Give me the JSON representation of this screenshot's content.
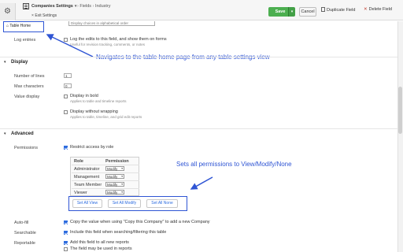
{
  "toolbar": {
    "app_name": "Companies Settings",
    "crumb_1": "Fields",
    "crumb_2": "Industry",
    "exit_label": "Exit Settings",
    "save_label": "Save",
    "cancel_label": "Cancel",
    "duplicate_label": "Duplicate Field",
    "delete_label": "Delete Field"
  },
  "table_home": {
    "label": "Table Home"
  },
  "top": {
    "dropdown_value": "Display choices in alphabetical order",
    "log_entries_label": "Log entries",
    "log_checkbox_label": "Log the edits to this field, and show them on forms",
    "log_checkbox_sub": "Useful for revision tracking, comments, or notes"
  },
  "display": {
    "section_title": "Display",
    "num_lines_label": "Number of lines",
    "num_lines_value": "1",
    "max_chars_label": "Max characters",
    "max_chars_value": "0",
    "value_display_label": "Value display",
    "bold_label": "Display in bold",
    "bold_sub": "Applies to table and timeline reports",
    "nowrap_label": "Display without wrapping",
    "nowrap_sub": "Applies to table, timeline, and grid edit reports"
  },
  "advanced": {
    "section_title": "Advanced",
    "permissions_label": "Permissions",
    "restrict_label": "Restrict access by role",
    "table_headers": {
      "role": "Role",
      "permission": "Permission"
    },
    "roles": [
      {
        "name": "Administrator",
        "permission": "Modify"
      },
      {
        "name": "Management",
        "permission": "Modify"
      },
      {
        "name": "Team Member",
        "permission": "Modify"
      },
      {
        "name": "Viewer",
        "permission": "Modify"
      }
    ],
    "set_all_view": "Set All View",
    "set_all_modify": "Set All Modify",
    "set_all_none": "Set All None",
    "autofill_label": "Auto-fill",
    "autofill_text": "Copy the value when using \"Copy this Company\" to add a new Company",
    "searchable_label": "Searchable",
    "searchable_text": "Include this field when searching/filtering this table",
    "reportable_label": "Reportable",
    "reportable_text_1": "Add this field to all new reports",
    "reportable_text_2": "The field may be used in reports"
  },
  "annotations": {
    "table_home_note": "Navigates to the table home page from any table settings view",
    "permissions_note": "Sets all permissions to View/Modify/None"
  },
  "colors": {
    "accent_blue": "#2f55d4",
    "save_green": "#4caf50",
    "link_blue": "#2d6cdf"
  },
  "icons": {
    "gear": "gear-icon",
    "app": "table-icon",
    "duplicate": "copy-icon",
    "delete": "close-icon"
  }
}
